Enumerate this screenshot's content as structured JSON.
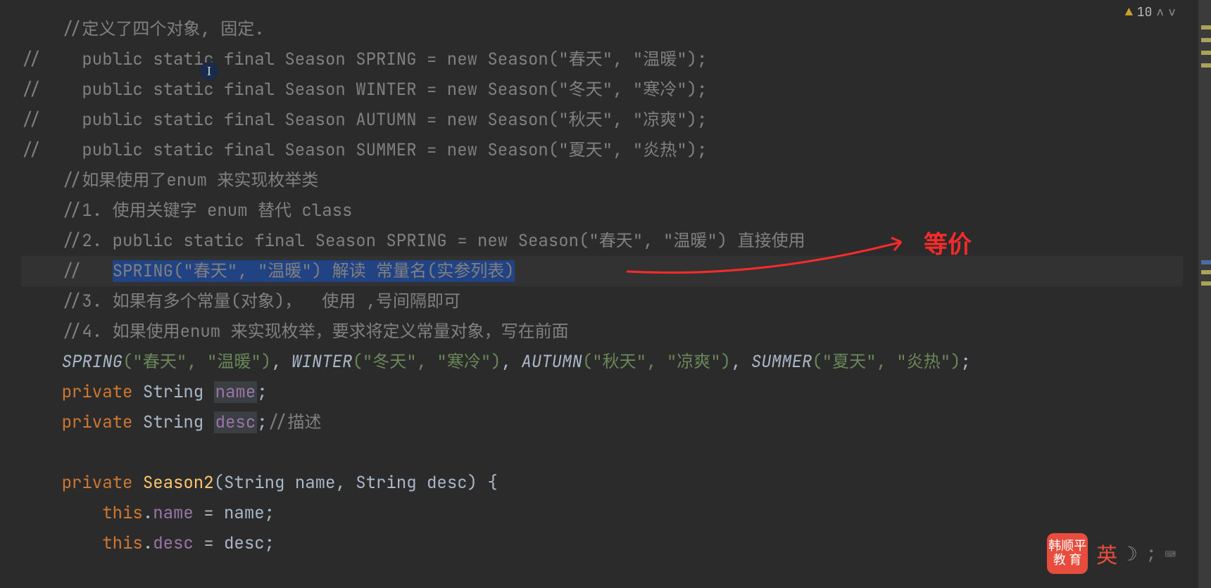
{
  "warnings": {
    "icon": "▲",
    "count": "10",
    "up": "∧",
    "down": "∨"
  },
  "annotation": {
    "text": "等价"
  },
  "bottom": {
    "badge_line1": "韩顺平",
    "badge_line2": "教 育",
    "ime": "英",
    "moon": "☽",
    "kbd": "⌨"
  },
  "lines": {
    "l1": "    //定义了四个对象, 固定.",
    "l2_a": "//    ",
    "l2_b": "public static final Season SPRING = new Season(\"春天\", \"温暖\");",
    "l3_a": "//    ",
    "l3_b": "public static final Season WINTER = new Season(\"冬天\", \"寒冷\");",
    "l4_a": "//    ",
    "l4_b": "public static final Season AUTUMN = new Season(\"秋天\", \"凉爽\");",
    "l5_a": "//    ",
    "l5_b": "public static final Season SUMMER = new Season(\"夏天\", \"炎热\");",
    "l6": "    //如果使用了enum 来实现枚举类",
    "l7": "    //1. 使用关键字 enum 替代 class",
    "l8": "    //2. public static final Season SPRING = new Season(\"春天\", \"温暖\") 直接使用",
    "l9_a": "    //   ",
    "l9_b": "SPRING(\"春天\", \"温暖\") 解读 常量名(实参列表)",
    "l10": "    //3. 如果有多个常量(对象)，  使用 ,号间隔即可",
    "l11": "    //4. 如果使用enum 来实现枚举，要求将定义常量对象，写在前面",
    "l12_spring": "SPRING",
    "l12_spr_args": "(\"春天\", \"温暖\")",
    "l12_c1": ", ",
    "l12_winter": "WINTER",
    "l12_win_args": "(\"冬天\", \"寒冷\")",
    "l12_c2": ", ",
    "l12_autumn": "AUTUMN",
    "l12_aut_args": "(\"秋天\", \"凉爽\")",
    "l12_c3": ", ",
    "l12_summer": "SUMMER",
    "l12_sum_args": "(\"夏天\", \"炎热\")",
    "l12_end": ";",
    "l13_kw": "private ",
    "l13_type": "String ",
    "l13_field": "name",
    "l13_end": ";",
    "l14_kw": "private ",
    "l14_type": "String ",
    "l14_field": "desc",
    "l14_end": ";",
    "l14_cm": "//描述",
    "l16_kw": "private ",
    "l16_func": "Season2",
    "l16_sig": "(String name, String desc) {",
    "l17_this": "this",
    "l17_dot": ".",
    "l17_field": "name",
    "l17_rest": " = name;",
    "l18_this": "this",
    "l18_dot": ".",
    "l18_field": "desc",
    "l18_rest": " = desc;"
  }
}
